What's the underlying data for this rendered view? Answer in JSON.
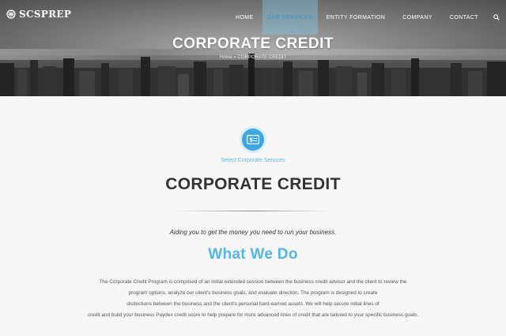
{
  "brand": {
    "name": "SCSPREP"
  },
  "nav": {
    "items": [
      {
        "label": "HOME"
      },
      {
        "label": "OUR SERVICES"
      },
      {
        "label": "ENTITY FORMATION"
      },
      {
        "label": "COMPANY"
      },
      {
        "label": "CONTACT"
      }
    ],
    "active_index": 1,
    "search_icon": "search-icon"
  },
  "hero": {
    "title": "CORPORATE CREDIT",
    "breadcrumb": "Home » CORPORATE CREDIT"
  },
  "main": {
    "service_icon": "dollar-card-icon",
    "select_label": "Select Corporate Services",
    "title": "CORPORATE CREDIT",
    "tagline": "Aiding you to get the money you need to run your business.",
    "section_title": "What We Do",
    "paragraph_lines": [
      "The Corporate Credit Program is comprised of an initial extended session between the business credit advisor and the client to review the",
      "program options, analyze our client's business goals, and evaluate direction. The program is designed to create",
      "distinctions between the business and the client's personal hard-earned assets. We will help secure initial lines of",
      "credit and build your business Paydex credit score to help prepare for more advanced lines of credit that are tailored to your specific business goals."
    ]
  },
  "colors": {
    "accent": "#3ea6e0",
    "accent_light": "#55b6e8",
    "nav_active_bg": "#85c3e0",
    "text_dark": "#333333",
    "text_body": "#555555"
  }
}
